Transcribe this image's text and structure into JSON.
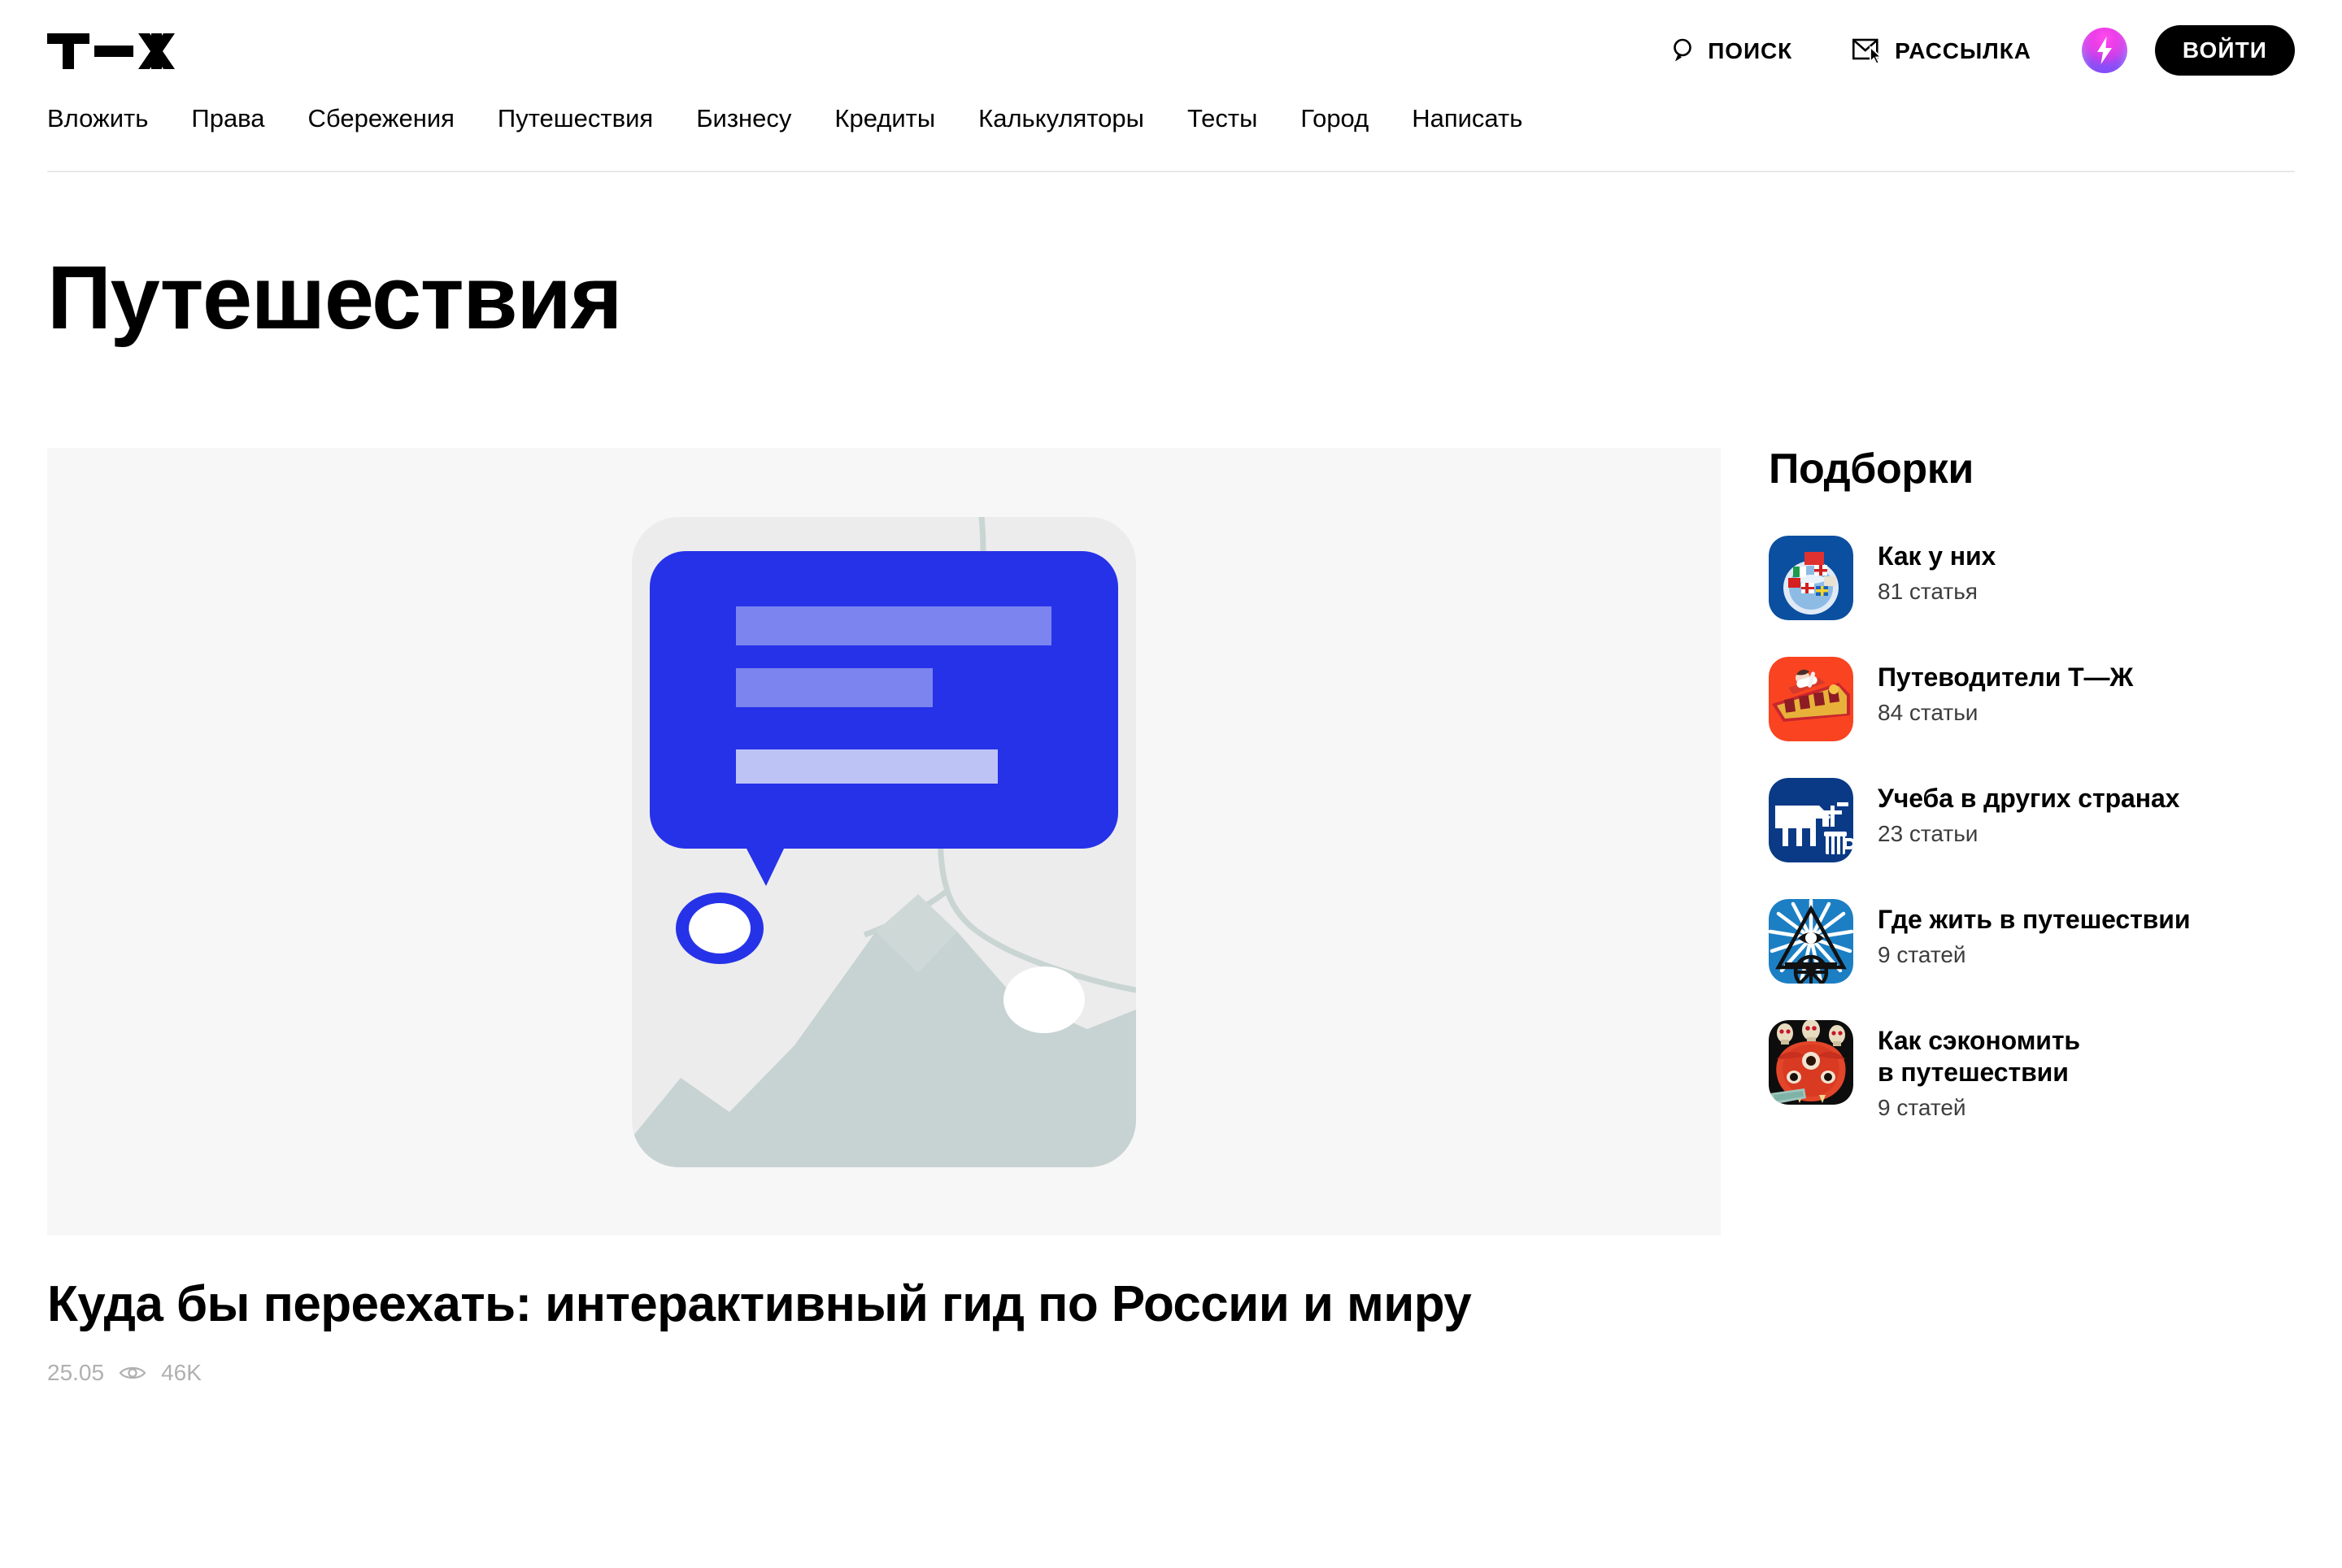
{
  "brand": {
    "logo_text": "Т—Ж"
  },
  "header": {
    "search_label": "Поиск",
    "newsletter_label": "Рассылка",
    "bolt_label": "bolt-badge",
    "login_label": "Войти",
    "nav_items": [
      {
        "label": "Вложить"
      },
      {
        "label": "Права"
      },
      {
        "label": "Сбережения"
      },
      {
        "label": "Путешествия"
      },
      {
        "label": "Бизнесу"
      },
      {
        "label": "Кредиты"
      },
      {
        "label": "Калькуляторы"
      },
      {
        "label": "Тесты"
      },
      {
        "label": "Город"
      },
      {
        "label": "Написать"
      }
    ]
  },
  "page": {
    "title": "Путешествия"
  },
  "hero": {
    "title": "Куда бы переехать: интерактивный гид по России и миру",
    "date": "25.05",
    "views": "46K",
    "illustration": "map-speech-bubble-illustration"
  },
  "sidebar": {
    "title": "Подборки",
    "collections": [
      {
        "name": "Как у них",
        "count": "81 статья",
        "icon": "flags-globe-icon"
      },
      {
        "name": "Путеводители Т—Ж",
        "count": "84 статьи",
        "icon": "tram-icon"
      },
      {
        "name": "Учеба в других странах",
        "count": "23 статьи",
        "icon": "cow-mug-icon"
      },
      {
        "name": "Где жить в путешествии",
        "count": "9 статей",
        "icon": "all-seeing-eye-icon"
      },
      {
        "name": "Как сэкономить\nв путешествии",
        "count": "9 статей",
        "icon": "red-demon-mask-icon"
      }
    ]
  },
  "colors": {
    "accent_blue": "#2632E8",
    "bubble_light": "#7B84EF",
    "bubble_lighter": "#BEC3F5",
    "hero_bg": "#F7F7F7",
    "map_land": "#C7D3D2",
    "text": "#000000",
    "muted": "#B0B0B0",
    "rule": "#E8E8E8"
  }
}
